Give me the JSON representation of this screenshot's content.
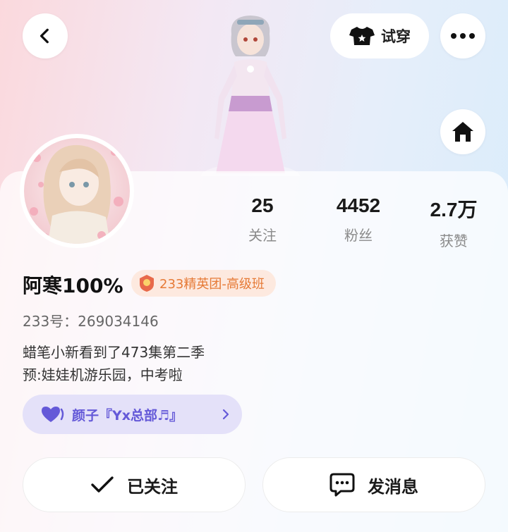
{
  "header": {
    "back_icon": "chevron-left-icon",
    "tryon_label": "试穿",
    "tryon_icon": "tshirt-icon",
    "more_icon": "more-dots-icon",
    "home_icon": "home-icon"
  },
  "profile": {
    "name": "阿寒100%",
    "badge_label": "233精英团-高级班",
    "uid": "233号：269034146",
    "bio_line1": "蜡笔小新看到了473集第二季",
    "bio_line2": "预:娃娃机游乐园，中考啦"
  },
  "stats": [
    {
      "value": "25",
      "label": "关注"
    },
    {
      "value": "4452",
      "label": "粉丝"
    },
    {
      "value": "2.7万",
      "label": "获赞"
    }
  ],
  "group": {
    "label": "颜子『Yx总部♬』"
  },
  "actions": {
    "follow_label": "已关注",
    "message_label": "发消息"
  },
  "colors": {
    "badge_text": "#e67a36",
    "group_text": "#6459d8",
    "group_bg": "#e4e1f9"
  }
}
